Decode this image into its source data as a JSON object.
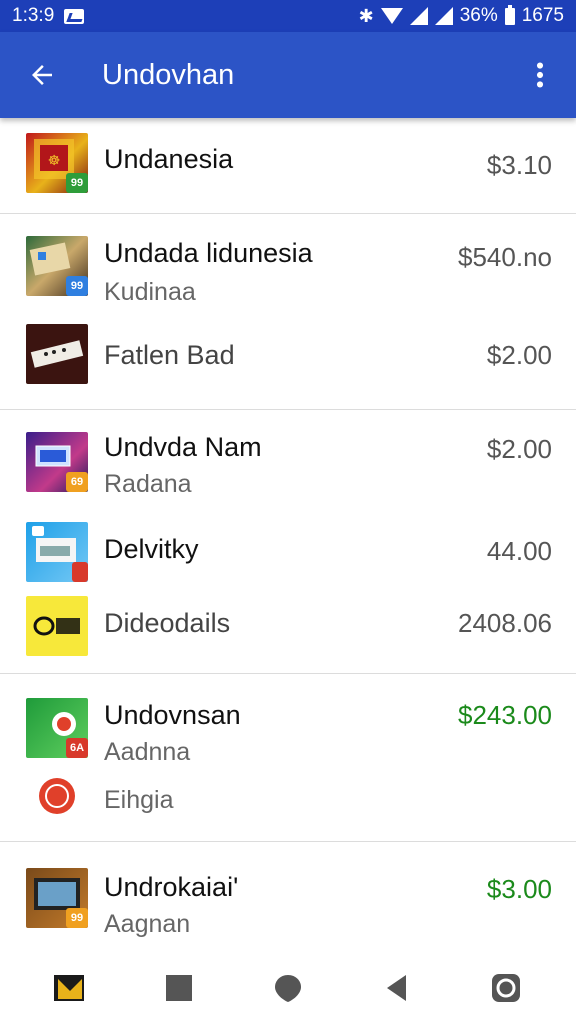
{
  "status_bar": {
    "time": "1:3:9",
    "battery_percent": "36%",
    "clock_right": "1675",
    "icons": [
      "notification-icon",
      "bluetooth-icon",
      "wifi-icon",
      "signal-icon",
      "battery-icon"
    ]
  },
  "app_bar": {
    "title": "Undovhan",
    "icons": [
      "back-arrow-icon",
      "more-vert-icon"
    ]
  },
  "groups": [
    {
      "items": [
        {
          "title": "Undanesia",
          "subtitle": "",
          "price": "$3.10",
          "price_color": "#555555",
          "thumb": "red-gold-game-thumb",
          "badge": "99",
          "badge_color": "#2e9d3a"
        }
      ]
    },
    {
      "items": [
        {
          "title": "Undada lidunesia",
          "subtitle": "Kudinaa",
          "price": "$540.no",
          "price_color": "#555555",
          "thumb": "board-game-thumb",
          "badge": "99",
          "badge_color": "#2f7fe0"
        },
        {
          "title": "Fatlen Bad",
          "subtitle": "",
          "price": "$2.00",
          "price_color": "#555555",
          "thumb": "domino-thumb",
          "badge": "",
          "badge_color": ""
        }
      ]
    },
    {
      "items": [
        {
          "title": "Undvda Nam",
          "subtitle": "Radana",
          "price": "$2.00",
          "price_color": "#555555",
          "thumb": "arcade-thumb",
          "badge": "69",
          "badge_color": "#f0a020"
        },
        {
          "title": "Delvitky",
          "subtitle": "",
          "price": "44.00",
          "price_color": "#555555",
          "thumb": "blue-card-thumb",
          "badge": "",
          "badge_color": ""
        },
        {
          "title": "Dideodails",
          "subtitle": "",
          "price": "2408.06",
          "price_color": "#555555",
          "thumb": "yellow-logo-thumb",
          "badge": "",
          "badge_color": ""
        }
      ]
    },
    {
      "items": [
        {
          "title": "Undovnsan",
          "subtitle": "Aadnna",
          "price": "$243.00",
          "price_color": "#1b8a1b",
          "thumb": "green-red-thumb",
          "badge": "6A",
          "badge_color": "#d8392b"
        },
        {
          "title": "",
          "subtitle": "Eihgia",
          "price": "",
          "price_color": "#555555",
          "thumb": "red-circle-thumb",
          "badge": "",
          "badge_color": ""
        }
      ]
    },
    {
      "items": [
        {
          "title": "Undrokaiai'",
          "subtitle": "Aagnan",
          "price": "$3.00",
          "price_color": "#1b8a1b",
          "thumb": "tv-thumb",
          "badge": "99",
          "badge_color": "#f0a020"
        }
      ]
    }
  ],
  "nav_bar": {
    "icons": [
      "app-shortcut-icon",
      "square-icon",
      "circle-icon",
      "back-triangle-icon",
      "camera-icon"
    ]
  }
}
